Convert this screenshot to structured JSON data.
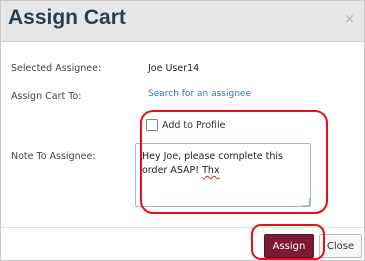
{
  "dialog": {
    "title": "Assign Cart",
    "close_icon": "close-icon",
    "close_glyph": "×"
  },
  "fields": {
    "selected_assignee_label": "Selected Assignee:",
    "selected_assignee_value": "Joe User14",
    "assign_to_label": "Assign Cart To:",
    "assign_to_link": "Search for an assignee",
    "add_to_profile_label": "Add to Profile",
    "add_to_profile_checked": false,
    "note_label": "Note To Assignee:",
    "note_value_main": "Hey Joe, please complete this order ASAP!",
    "note_value_misspelled": "Thx"
  },
  "buttons": {
    "assign_label": "Assign",
    "close_label": "Close"
  },
  "colors": {
    "accent_button": "#7b1a32",
    "link": "#2c79c5",
    "annotation": "#e3111b"
  }
}
